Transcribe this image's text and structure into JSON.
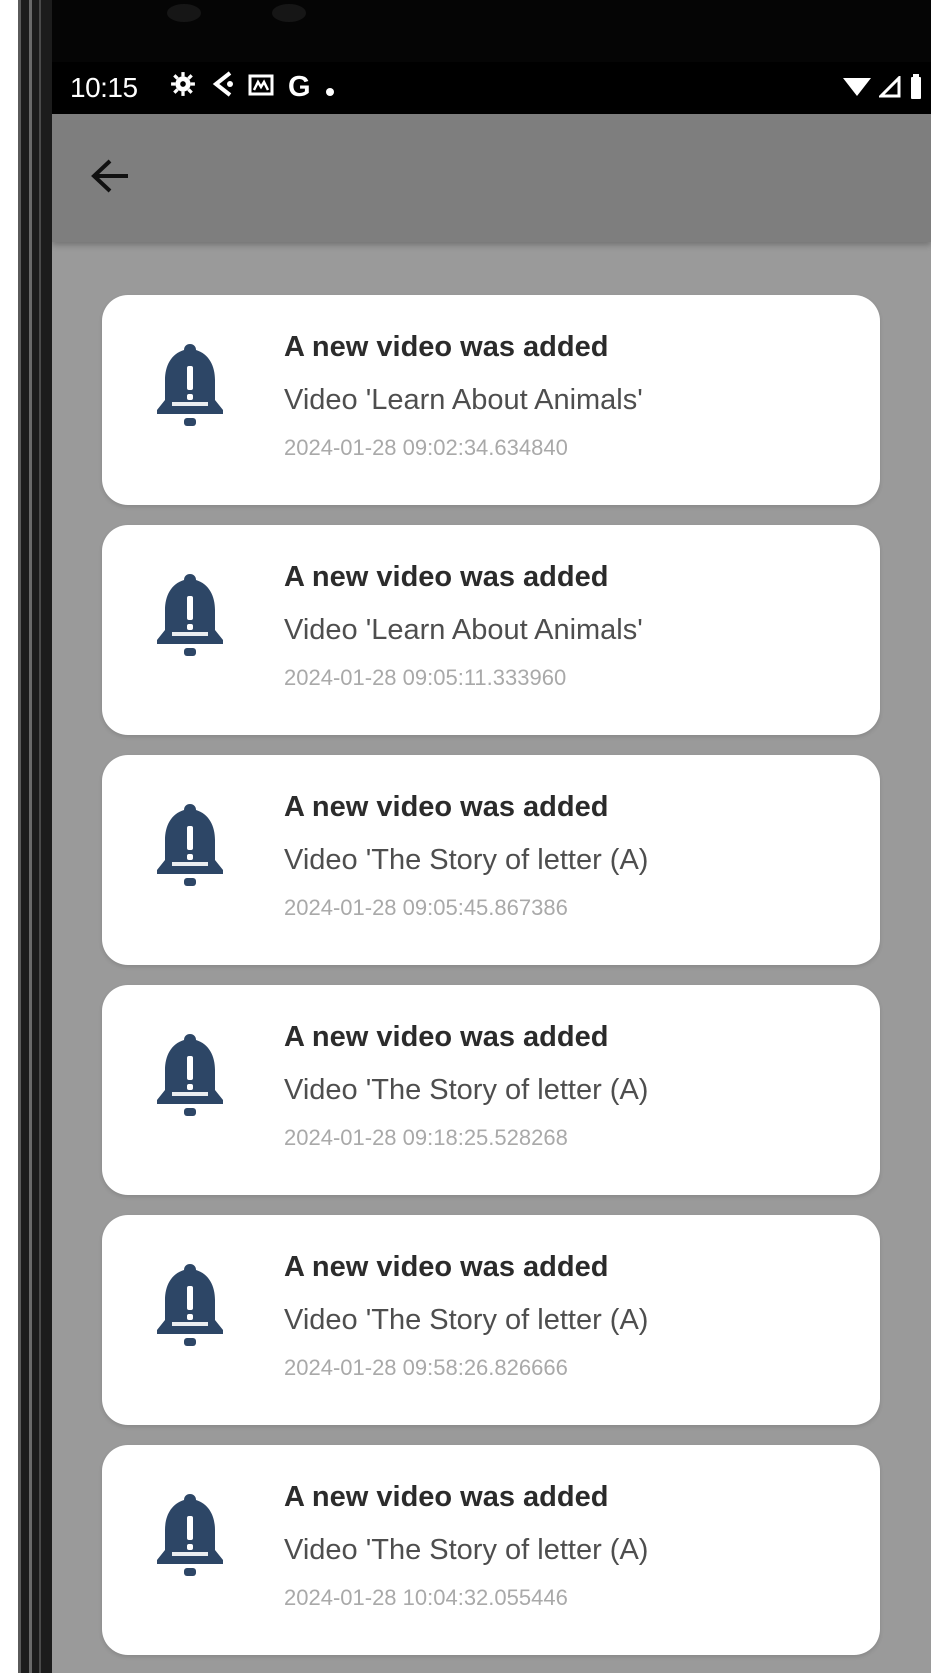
{
  "status_bar": {
    "time": "10:15",
    "left_icons": [
      "settings-icon",
      "share-icon",
      "cast-icon",
      "google-icon",
      "dot-icon"
    ],
    "right_icons": [
      "wifi-icon",
      "signal-icon",
      "battery-icon"
    ]
  },
  "app_bar": {
    "back_icon": "arrow-back-icon"
  },
  "colors": {
    "bell": "#2d4666",
    "page_background": "#9a9a9a",
    "app_bar": "#7e7e7e",
    "card": "#ffffff"
  },
  "notifications": [
    {
      "title": "A new video was added",
      "subtitle": "Video 'Learn About Animals'",
      "timestamp": "2024-01-28 09:02:34.634840",
      "icon": "bell-icon"
    },
    {
      "title": "A new video was added",
      "subtitle": "Video 'Learn About Animals'",
      "timestamp": "2024-01-28 09:05:11.333960",
      "icon": "bell-icon"
    },
    {
      "title": "A new video was added",
      "subtitle": "Video 'The Story of letter (A)",
      "timestamp": "2024-01-28 09:05:45.867386",
      "icon": "bell-icon"
    },
    {
      "title": "A new video was added",
      "subtitle": "Video 'The Story of letter (A)",
      "timestamp": "2024-01-28 09:18:25.528268",
      "icon": "bell-icon"
    },
    {
      "title": "A new video was added",
      "subtitle": "Video 'The Story of letter (A)",
      "timestamp": "2024-01-28 09:58:26.826666",
      "icon": "bell-icon"
    },
    {
      "title": "A new video was added",
      "subtitle": "Video 'The Story of letter (A)",
      "timestamp": "2024-01-28 10:04:32.055446",
      "icon": "bell-icon"
    }
  ]
}
